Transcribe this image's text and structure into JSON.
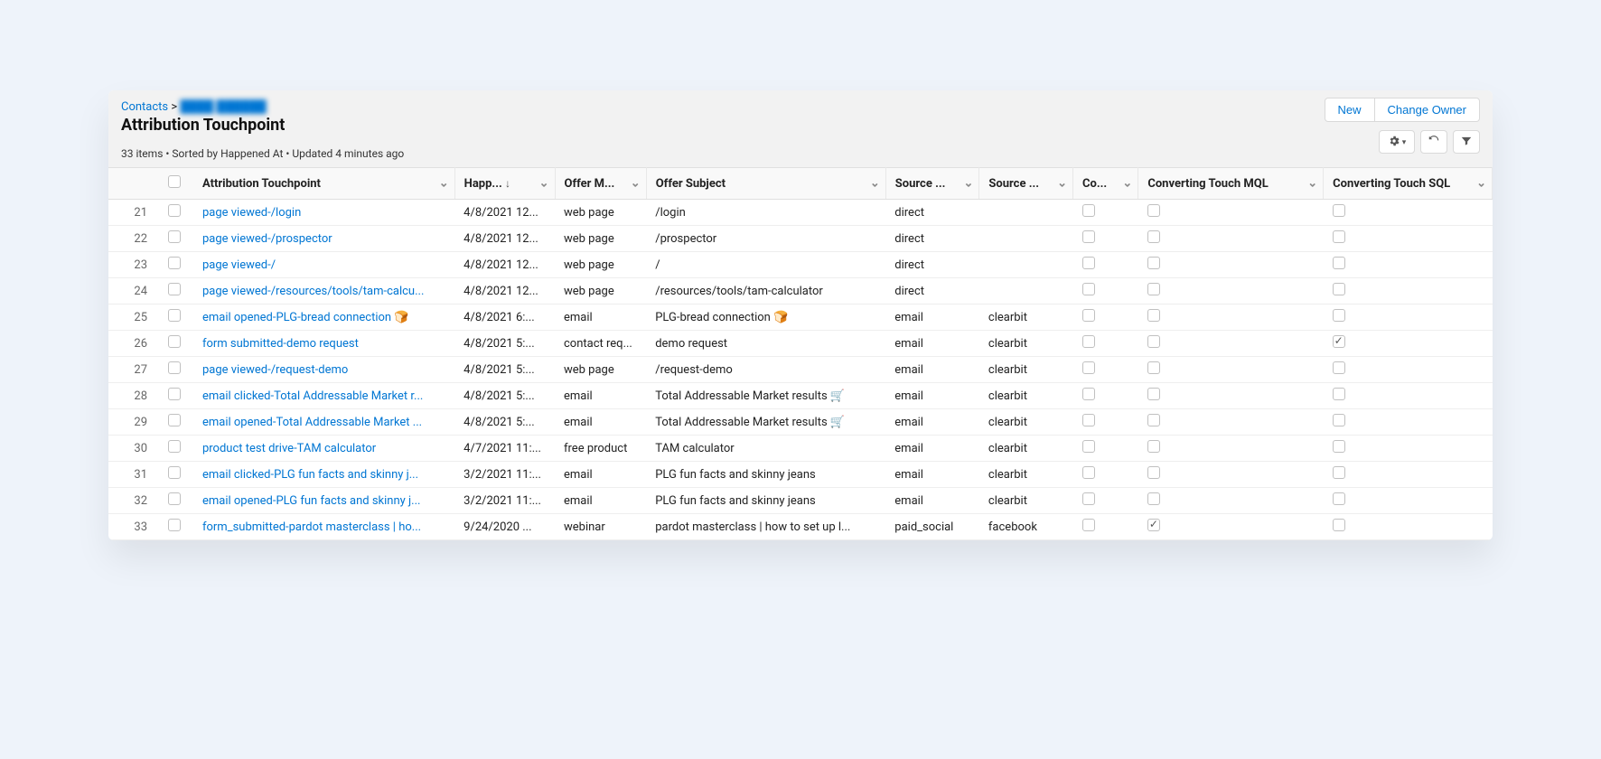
{
  "breadcrumb": {
    "root": "Contacts",
    "sep": ">",
    "redacted": "████ ██████"
  },
  "title": "Attribution Touchpoint",
  "meta": "33 items • Sorted by Happened At • Updated 4 minutes ago",
  "buttons": {
    "new": "New",
    "change_owner": "Change Owner"
  },
  "columns": {
    "attr": "Attribution Touchpoint",
    "happ": "Happ...",
    "offer_m": "Offer M...",
    "subject": "Offer Subject",
    "src1": "Source ...",
    "src2": "Source ...",
    "co": "Co...",
    "mql": "Converting Touch MQL",
    "sql": "Converting Touch SQL"
  },
  "rows": [
    {
      "n": 21,
      "name": "page viewed-/login",
      "happ": "4/8/2021 12...",
      "offer": "web page",
      "subject": "/login",
      "s1": "direct",
      "s2": "",
      "co": false,
      "mql": false,
      "sql": false
    },
    {
      "n": 22,
      "name": "page viewed-/prospector",
      "happ": "4/8/2021 12...",
      "offer": "web page",
      "subject": "/prospector",
      "s1": "direct",
      "s2": "",
      "co": false,
      "mql": false,
      "sql": false
    },
    {
      "n": 23,
      "name": "page viewed-/",
      "happ": "4/8/2021 12...",
      "offer": "web page",
      "subject": "/",
      "s1": "direct",
      "s2": "",
      "co": false,
      "mql": false,
      "sql": false
    },
    {
      "n": 24,
      "name": "page viewed-/resources/tools/tam-calcu...",
      "happ": "4/8/2021 12...",
      "offer": "web page",
      "subject": "/resources/tools/tam-calculator",
      "s1": "direct",
      "s2": "",
      "co": false,
      "mql": false,
      "sql": false
    },
    {
      "n": 25,
      "name": "email opened-PLG-bread connection 🍞",
      "happ": "4/8/2021 6:...",
      "offer": "email",
      "subject": "PLG-bread connection 🍞",
      "s1": "email",
      "s2": "clearbit",
      "co": false,
      "mql": false,
      "sql": false
    },
    {
      "n": 26,
      "name": "form submitted-demo request",
      "happ": "4/8/2021 5:...",
      "offer": "contact req...",
      "subject": "demo request",
      "s1": "email",
      "s2": "clearbit",
      "co": false,
      "mql": false,
      "sql": true
    },
    {
      "n": 27,
      "name": "page viewed-/request-demo",
      "happ": "4/8/2021 5:...",
      "offer": "web page",
      "subject": "/request-demo",
      "s1": "email",
      "s2": "clearbit",
      "co": false,
      "mql": false,
      "sql": false
    },
    {
      "n": 28,
      "name": "email clicked-Total Addressable Market r...",
      "happ": "4/8/2021 5:...",
      "offer": "email",
      "subject": "Total Addressable Market results 🛒",
      "s1": "email",
      "s2": "clearbit",
      "co": false,
      "mql": false,
      "sql": false
    },
    {
      "n": 29,
      "name": "email opened-Total Addressable Market ...",
      "happ": "4/8/2021 5:...",
      "offer": "email",
      "subject": "Total Addressable Market results 🛒",
      "s1": "email",
      "s2": "clearbit",
      "co": false,
      "mql": false,
      "sql": false
    },
    {
      "n": 30,
      "name": "product test drive-TAM calculator",
      "happ": "4/7/2021 11:...",
      "offer": "free product",
      "subject": "TAM calculator",
      "s1": "email",
      "s2": "clearbit",
      "co": false,
      "mql": false,
      "sql": false
    },
    {
      "n": 31,
      "name": "email clicked-PLG fun facts and skinny j...",
      "happ": "3/2/2021 11:...",
      "offer": "email",
      "subject": "PLG fun facts and skinny jeans",
      "s1": "email",
      "s2": "clearbit",
      "co": false,
      "mql": false,
      "sql": false
    },
    {
      "n": 32,
      "name": "email opened-PLG fun facts and skinny j...",
      "happ": "3/2/2021 11:...",
      "offer": "email",
      "subject": "PLG fun facts and skinny jeans",
      "s1": "email",
      "s2": "clearbit",
      "co": false,
      "mql": false,
      "sql": false
    },
    {
      "n": 33,
      "name": "form_submitted-pardot masterclass | ho...",
      "happ": "9/24/2020 ...",
      "offer": "webinar",
      "subject": "pardot masterclass | how to set up l...",
      "s1": "paid_social",
      "s2": "facebook",
      "co": false,
      "mql": true,
      "sql": false
    }
  ]
}
